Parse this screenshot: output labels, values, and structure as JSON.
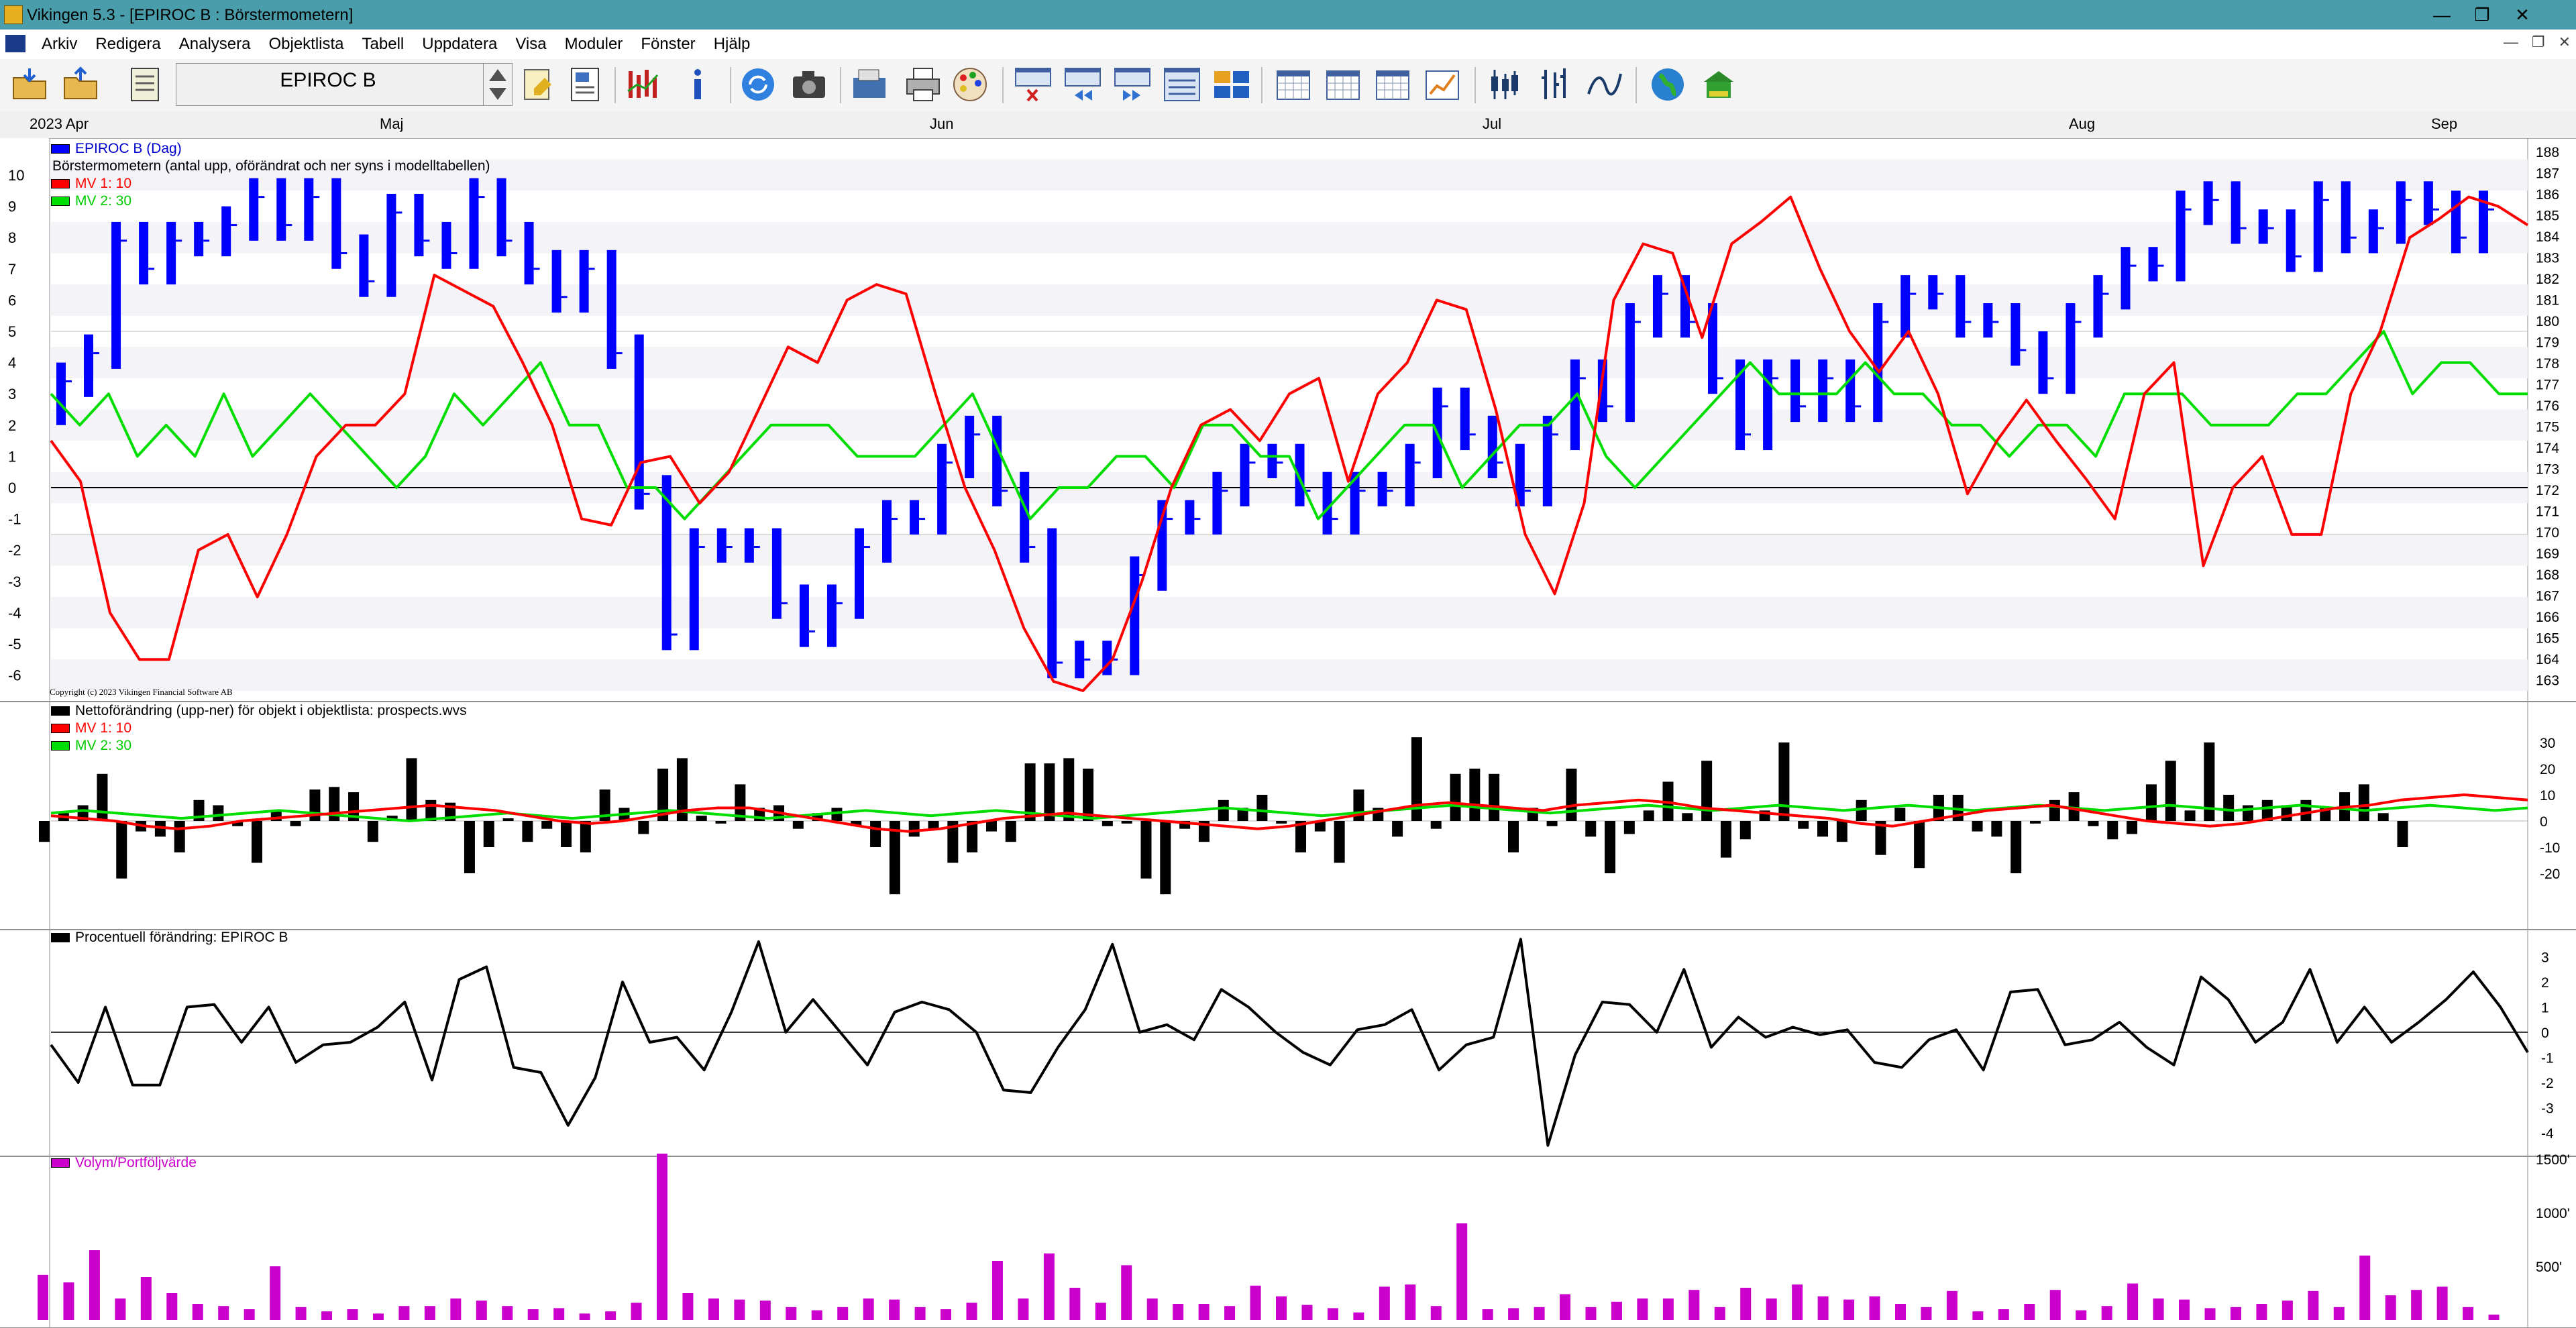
{
  "window": {
    "title": "Vikingen 5.3 - [EPIROC B : Börstermometern]"
  },
  "menu": [
    "Arkiv",
    "Redigera",
    "Analysera",
    "Objektlista",
    "Tabell",
    "Uppdatera",
    "Visa",
    "Moduler",
    "Fönster",
    "Hjälp"
  ],
  "toolbar": {
    "symbol": "EPIROC B"
  },
  "timeline": {
    "year_label": "2023 Apr",
    "months": [
      "Maj",
      "Jun",
      "Jul",
      "Aug",
      "Sep"
    ]
  },
  "copyright": "Copyright (c) 2023 Vikingen Financial Software AB",
  "colors": {
    "blue": "#0000ff",
    "red": "#ff0000",
    "green": "#00dd00",
    "black": "#000000",
    "magenta": "#cc00cc",
    "titlebar": "#4a9eab"
  },
  "chart_data": [
    {
      "type": "bar",
      "panel": "main",
      "legend": [
        "EPIROC B (Dag)",
        "Börstermometern (antal upp, oförändrat och ner syns i modelltabellen)",
        "MV 1: 10",
        "MV 2: 30"
      ],
      "left_ticks": [
        10,
        9,
        8,
        7,
        6,
        5,
        4,
        3,
        2,
        1,
        0,
        -1,
        -2,
        -3,
        -4,
        -5,
        -6
      ],
      "right_ticks": [
        188,
        187,
        186,
        185,
        184,
        183,
        182,
        181,
        180,
        179,
        178,
        177,
        176,
        175,
        174,
        173,
        172,
        171,
        170,
        169,
        168,
        167,
        166,
        165,
        164,
        163
      ],
      "series": [
        {
          "name": "EPIROC B (Dag)",
          "values": [
            1,
            1,
            4,
            -1,
            1,
            0,
            3,
            1,
            -1,
            1,
            -2,
            -1,
            4,
            -1,
            4,
            2,
            2,
            -1,
            -1,
            1,
            -3,
            -5,
            -5,
            -6,
            0,
            0,
            -2,
            -1,
            1,
            2,
            1,
            0,
            2,
            1,
            -2,
            -2,
            -5,
            -1,
            0,
            3,
            2,
            0,
            1,
            1,
            0,
            -1,
            -1,
            1,
            0,
            1,
            2,
            -1,
            -1,
            -1,
            2,
            2,
            -1,
            3,
            1,
            -1,
            -2,
            -2,
            2,
            -1,
            1,
            -1,
            3,
            1,
            0,
            -1,
            0,
            -1,
            -1,
            2,
            1,
            1,
            0,
            2,
            1,
            -1,
            0,
            -1,
            2,
            2,
            3,
            1,
            1,
            -1,
            1
          ]
        },
        {
          "name": "MV 1: 10",
          "values": [
            1.5,
            0.2,
            -4,
            -5.5,
            -5.5,
            -2,
            -1.5,
            -3.5,
            -1.5,
            1,
            2,
            2,
            3,
            6.8,
            6.3,
            5.8,
            4,
            2,
            -1,
            -1.2,
            0.8,
            1,
            -0.5,
            0.5,
            2.5,
            4.5,
            4,
            6,
            6.5,
            6.2,
            3,
            0,
            -2,
            -4.5,
            -6.2,
            -6.5,
            -5.5,
            -3,
            0,
            2,
            2.5,
            1.5,
            3,
            3.5,
            0.2,
            3,
            4,
            6,
            5.7,
            2.5,
            -1.5,
            -3.4,
            -0.5,
            6,
            7.8,
            7.5,
            4.8,
            7.8,
            8.5,
            9.3,
            7,
            5,
            3.7,
            5,
            3,
            -0.2,
            1.5,
            2.8,
            1.5,
            0.3,
            -1,
            3,
            4,
            -2.5,
            0,
            1,
            -1.5,
            -1.5,
            3,
            5,
            8,
            8.6,
            9.3,
            9,
            8.4
          ]
        },
        {
          "name": "MV 2: 30",
          "values": [
            3,
            2,
            3,
            1,
            2,
            1,
            3,
            1,
            2,
            3,
            2,
            1,
            0,
            1,
            3,
            2,
            3,
            4,
            2,
            2,
            0,
            0,
            -1,
            0,
            1,
            2,
            2,
            2,
            1,
            1,
            1,
            2,
            3,
            1,
            -1,
            0,
            0,
            1,
            1,
            0,
            2,
            2,
            1,
            1,
            -1,
            0,
            1,
            2,
            2,
            0,
            1,
            2,
            2,
            3,
            1,
            0,
            1,
            2,
            3,
            4,
            3,
            3,
            3,
            4,
            3,
            3,
            2,
            2,
            1,
            2,
            2,
            1,
            3,
            3,
            3,
            2,
            2,
            2,
            3,
            3,
            4,
            5,
            3,
            4,
            4,
            3,
            3
          ]
        }
      ]
    },
    {
      "type": "bar",
      "panel": "netto",
      "legend": [
        "Nettoförändring (upp-ner) för objekt i objektlista: prospects.wvs",
        "MV 1: 10",
        "MV 2: 30"
      ],
      "ticks": [
        30,
        20,
        10,
        0,
        -10,
        -20
      ]
    },
    {
      "type": "line",
      "panel": "percent",
      "legend": [
        "Procentuell förändring: EPIROC B"
      ],
      "ticks": [
        3,
        2,
        1,
        0,
        -1,
        -2,
        -3,
        -4
      ],
      "series": [
        {
          "name": "Procentuell förändring: EPIROC B",
          "values": [
            -0.5,
            -2,
            1,
            -2.1,
            -2.1,
            1,
            1.1,
            -0.4,
            1,
            -1.2,
            -0.5,
            -0.4,
            0.2,
            1.2,
            -1.9,
            2.1,
            2.6,
            -1.4,
            -1.6,
            -3.7,
            -1.8,
            2,
            -0.4,
            -0.2,
            -1.5,
            0.8,
            3.6,
            0,
            1.3,
            0,
            -1.3,
            0.8,
            1.2,
            0.9,
            0,
            -2.3,
            -2.4,
            -0.6,
            0.9,
            3.5,
            0,
            0.3,
            -0.3,
            1.7,
            1,
            0,
            -0.8,
            -1.3,
            0.1,
            0.3,
            0.9,
            -1.5,
            -0.5,
            -0.2,
            3.7,
            -4.5,
            -0.9,
            1.2,
            1.1,
            0,
            2.5,
            -0.6,
            0.6,
            -0.2,
            0.2,
            -0.1,
            0.1,
            -1.2,
            -1.4,
            -0.3,
            0.1,
            -1.5,
            1.6,
            1.7,
            -0.5,
            -0.3,
            0.4,
            -0.6,
            -1.3,
            2.2,
            1.3,
            -0.4,
            0.4,
            2.5,
            -0.4,
            1,
            -0.4,
            0.4,
            1.3,
            2.4,
            1,
            -0.8
          ]
        }
      ]
    },
    {
      "type": "bar",
      "panel": "volume",
      "legend": [
        "Volym/Portföljvärde"
      ],
      "ticks": [
        "1500'",
        "1000'",
        "500'"
      ],
      "series": [
        {
          "name": "Volym/Portföljvärde",
          "values": [
            420,
            350,
            650,
            200,
            400,
            250,
            150,
            130,
            100,
            500,
            120,
            80,
            100,
            60,
            130,
            130,
            200,
            180,
            130,
            100,
            110,
            60,
            80,
            160,
            1550,
            250,
            200,
            190,
            180,
            120,
            90,
            120,
            200,
            190,
            120,
            100,
            160,
            550,
            200,
            620,
            300,
            160,
            510,
            200,
            150,
            150,
            130,
            320,
            220,
            140,
            110,
            70,
            310,
            330,
            130,
            900,
            100,
            110,
            120,
            240,
            120,
            170,
            200,
            200,
            280,
            120,
            300,
            200,
            330,
            220,
            190,
            220,
            150,
            120,
            270,
            80,
            100,
            150,
            280,
            90,
            130,
            340,
            200,
            190,
            110,
            120,
            150,
            180,
            270,
            120,
            600,
            230,
            280,
            310,
            120,
            50
          ]
        }
      ]
    }
  ]
}
